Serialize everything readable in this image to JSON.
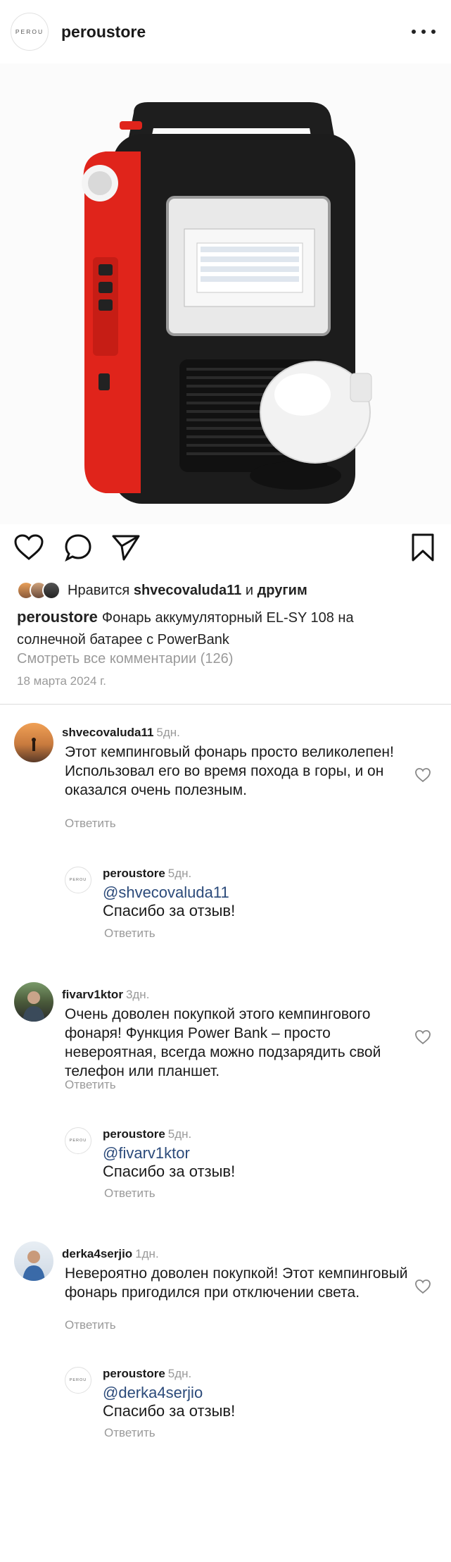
{
  "header": {
    "logo_text": "PEROU",
    "username": "peroustore",
    "more_icon": "more-dots-icon"
  },
  "post": {
    "image_alt": "solar-lantern-product-photo",
    "likes_prefix": "Нравится",
    "likes_user": "shvecovaluda11",
    "likes_and": "и",
    "likes_others": "другим",
    "caption_user": "peroustore",
    "caption_text": "Фонарь аккумуляторный EL-SY 108 на солнечной батарее с PowerBank",
    "view_all": "Смотреть все комментарии (126)",
    "date": "18 марта 2024 г."
  },
  "comments": [
    {
      "user": "shvecovaluda11",
      "time": "5дн.",
      "text": "Этот кемпинговый фонарь просто великолепен! Использовал его во время похода в горы, и он оказался очень полезным.",
      "reply_label": "Ответить",
      "reply": {
        "user": "peroustore",
        "time": "5дн.",
        "mention": "@shvecovaluda11",
        "text": "Спасибо за отзыв!",
        "reply_label": "Ответить"
      }
    },
    {
      "user": "fivarv1ktor",
      "time": "3дн.",
      "text": "Очень доволен покупкой этого кемпингового фонаря! Функция Power Bank – просто невероятная, всегда можно подзарядить свой телефон или планшет.",
      "reply_label": "Ответить",
      "reply": {
        "user": "peroustore",
        "time": "5дн.",
        "mention": "@fivarv1ktor",
        "text": "Спасибо за отзыв!",
        "reply_label": "Ответить"
      }
    },
    {
      "user": "derka4serjio",
      "time": "1дн.",
      "text": "Невероятно доволен покупкой! Этот кемпинговый фонарь пригодился при отключении света.",
      "reply_label": "Ответить",
      "reply": {
        "user": "peroustore",
        "time": "5дн.",
        "mention": "@derka4serjio",
        "text": "Спасибо за отзыв!",
        "reply_label": "Ответить"
      }
    }
  ]
}
